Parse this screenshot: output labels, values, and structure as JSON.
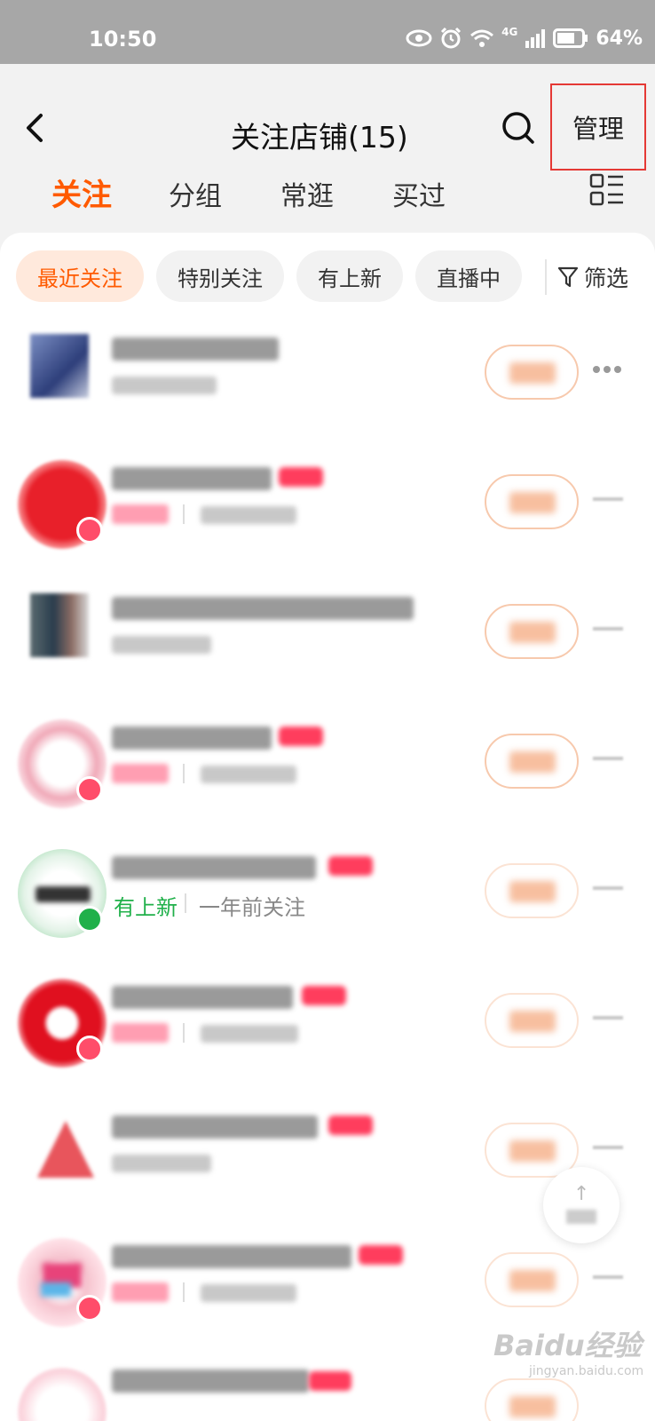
{
  "status_bar": {
    "time": "10:50",
    "network": "4G",
    "battery": "64%"
  },
  "header": {
    "title": "关注店铺(15)",
    "manage_label": "管理"
  },
  "tabs": [
    {
      "label": "关注",
      "active": true
    },
    {
      "label": "分组",
      "active": false
    },
    {
      "label": "常逛",
      "active": false
    },
    {
      "label": "买过",
      "active": false
    }
  ],
  "chips": [
    {
      "label": "最近关注",
      "active": true
    },
    {
      "label": "特别关注",
      "active": false
    },
    {
      "label": "有上新",
      "active": false
    },
    {
      "label": "直播中",
      "active": false
    }
  ],
  "filter_label": "筛选",
  "store_rows": [
    {
      "logo": "blurred-square",
      "live": false
    },
    {
      "logo": "blurred-red",
      "live": true
    },
    {
      "logo": "blurred-square",
      "live": false
    },
    {
      "logo": "blurred-lining",
      "live": true
    },
    {
      "logo": "blurred-puma",
      "live": false,
      "status": "有上新",
      "followed_time": "一年前关注"
    },
    {
      "logo": "blurred-red",
      "live": true
    },
    {
      "logo": "blurred-red-triangle",
      "live": false
    },
    {
      "logo": "blurred-pink",
      "live": true
    },
    {
      "logo": "blurred-pink",
      "live": false
    }
  ],
  "watermark": {
    "main": "Baidu经验",
    "sub": "jingyan.baidu.com"
  },
  "colors": {
    "accent": "#ff5a00",
    "highlight_border": "#e53935",
    "status_bar": "#a7a7a7"
  }
}
